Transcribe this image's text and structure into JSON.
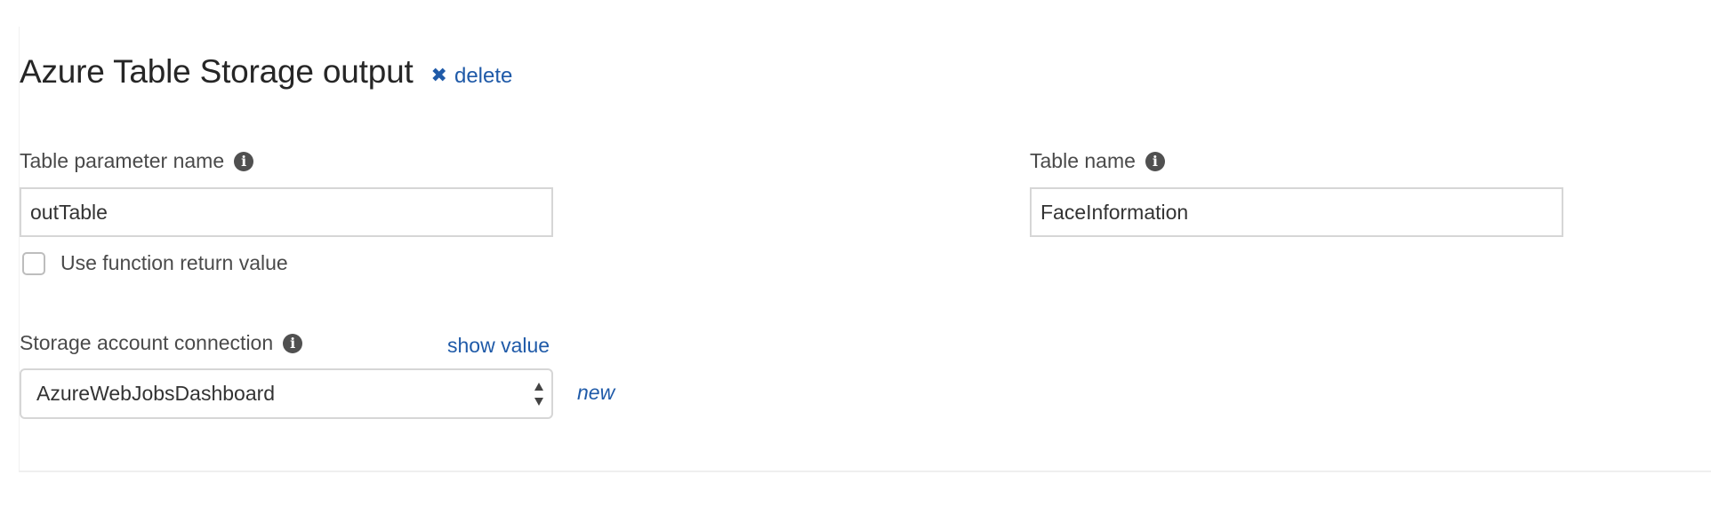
{
  "header": {
    "title": "Azure Table Storage output",
    "delete_label": "delete"
  },
  "fields": {
    "table_parameter": {
      "label": "Table parameter name",
      "value": "outTable"
    },
    "table_name": {
      "label": "Table name",
      "value": "FaceInformation"
    },
    "use_return_value": {
      "label": "Use function return value",
      "checked": false
    },
    "storage_connection": {
      "label": "Storage account connection",
      "show_value_label": "show value",
      "selected": "AzureWebJobsDashboard",
      "new_label": "new"
    }
  },
  "icons": {
    "info": "info-circle-icon",
    "delete": "close-x-icon",
    "select": "select-arrows-icon"
  },
  "colors": {
    "link": "#1f5aa8",
    "title": "#262626",
    "label": "#4a4a4a",
    "border": "#d6d6d6"
  }
}
